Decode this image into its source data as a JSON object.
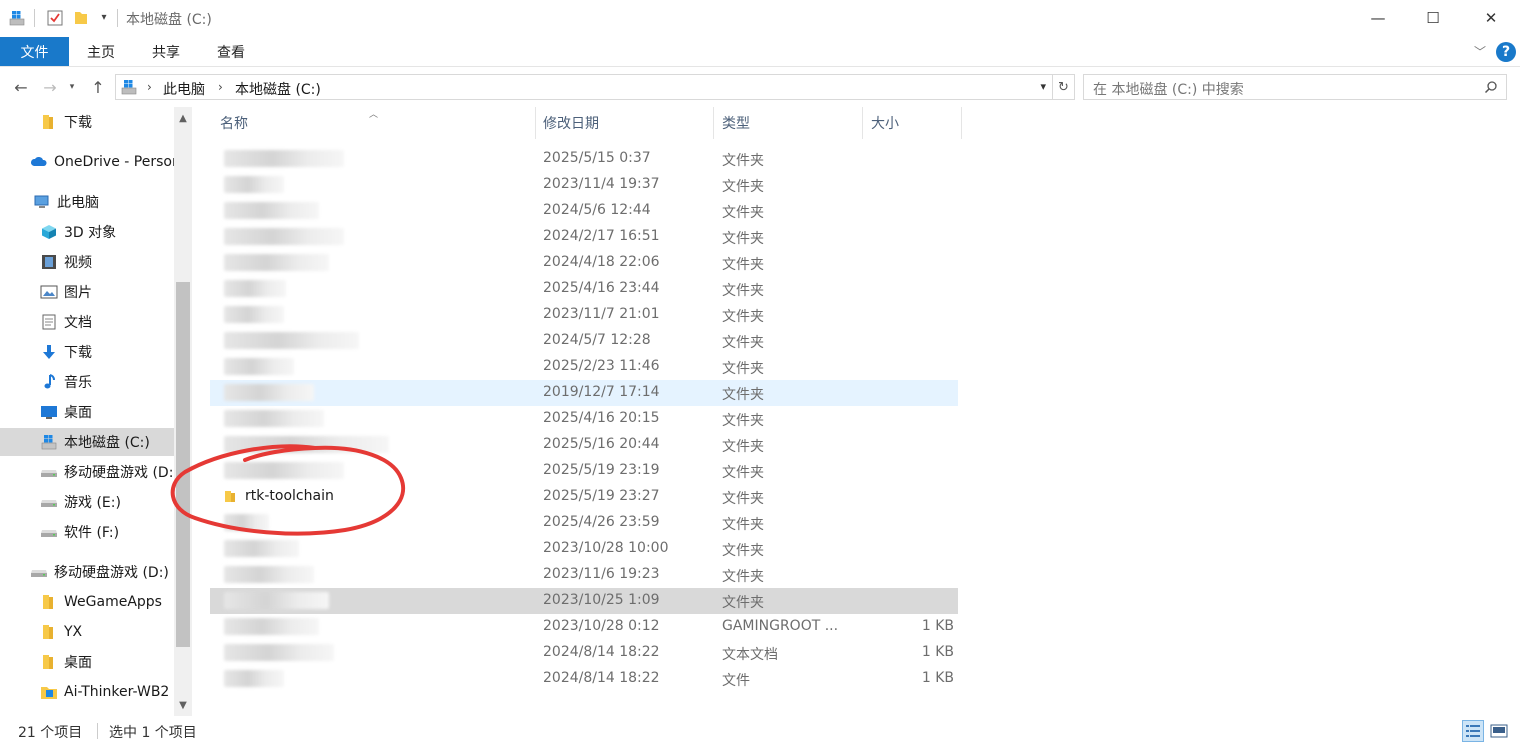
{
  "window": {
    "title": "本地磁盘 (C:)",
    "controls": {
      "minimize": "—",
      "maximize": "☐",
      "close": "✕"
    }
  },
  "ribbon": {
    "tabs": [
      "文件",
      "主页",
      "共享",
      "查看"
    ],
    "help": "?"
  },
  "address": {
    "breadcrumb": [
      "此电脑",
      "本地磁盘 (C:)"
    ],
    "search_placeholder": "在 本地磁盘 (C:) 中搜索"
  },
  "sidebar": {
    "items": [
      {
        "label": "下载",
        "icon": "folder-icon"
      },
      {
        "label": "OneDrive - Personal",
        "icon": "cloud-icon"
      },
      {
        "label": "此电脑",
        "icon": "computer-icon"
      },
      {
        "label": "3D 对象",
        "icon": "cube-icon"
      },
      {
        "label": "视频",
        "icon": "film-icon"
      },
      {
        "label": "图片",
        "icon": "picture-icon"
      },
      {
        "label": "文档",
        "icon": "document-icon"
      },
      {
        "label": "下载",
        "icon": "download-icon"
      },
      {
        "label": "音乐",
        "icon": "music-icon"
      },
      {
        "label": "桌面",
        "icon": "desktop-icon"
      },
      {
        "label": "本地磁盘 (C:)",
        "icon": "windows-drive-icon",
        "selected": true
      },
      {
        "label": "移动硬盘游戏 (D:)",
        "icon": "drive-icon"
      },
      {
        "label": "游戏 (E:)",
        "icon": "drive-icon"
      },
      {
        "label": "软件 (F:)",
        "icon": "drive-icon"
      },
      {
        "label": "移动硬盘游戏 (D:)",
        "icon": "drive-icon"
      },
      {
        "label": "WeGameApps",
        "icon": "folder-icon"
      },
      {
        "label": "YX",
        "icon": "folder-icon"
      },
      {
        "label": "桌面",
        "icon": "folder-icon"
      },
      {
        "label": "Ai-Thinker-WB2",
        "icon": "app-folder-icon"
      }
    ]
  },
  "columns": {
    "name": "名称",
    "date": "修改日期",
    "type": "类型",
    "size": "大小"
  },
  "files": [
    {
      "name": "",
      "date": "2025/5/15 0:37",
      "type": "文件夹",
      "size": ""
    },
    {
      "name": "",
      "date": "2023/11/4 19:37",
      "type": "文件夹",
      "size": ""
    },
    {
      "name": "",
      "date": "2024/5/6 12:44",
      "type": "文件夹",
      "size": ""
    },
    {
      "name": "",
      "date": "2024/2/17 16:51",
      "type": "文件夹",
      "size": ""
    },
    {
      "name": "",
      "date": "2024/4/18 22:06",
      "type": "文件夹",
      "size": ""
    },
    {
      "name": "",
      "date": "2025/4/16 23:44",
      "type": "文件夹",
      "size": ""
    },
    {
      "name": "",
      "date": "2023/11/7 21:01",
      "type": "文件夹",
      "size": ""
    },
    {
      "name": "",
      "date": "2024/5/7 12:28",
      "type": "文件夹",
      "size": ""
    },
    {
      "name": "",
      "date": "2025/2/23 11:46",
      "type": "文件夹",
      "size": ""
    },
    {
      "name": "",
      "date": "2019/12/7 17:14",
      "type": "文件夹",
      "size": "",
      "state": "hover"
    },
    {
      "name": "",
      "date": "2025/4/16 20:15",
      "type": "文件夹",
      "size": ""
    },
    {
      "name": "",
      "date": "2025/5/16 20:44",
      "type": "文件夹",
      "size": ""
    },
    {
      "name": "",
      "date": "2025/5/19 23:19",
      "type": "文件夹",
      "size": ""
    },
    {
      "name": "rtk-toolchain",
      "date": "2025/5/19 23:27",
      "type": "文件夹",
      "size": ""
    },
    {
      "name": "",
      "date": "2025/4/26 23:59",
      "type": "文件夹",
      "size": ""
    },
    {
      "name": "",
      "date": "2023/10/28 10:00",
      "type": "文件夹",
      "size": ""
    },
    {
      "name": "",
      "date": "2023/11/6 19:23",
      "type": "文件夹",
      "size": ""
    },
    {
      "name": "",
      "date": "2023/10/25 1:09",
      "type": "文件夹",
      "size": "",
      "state": "selected"
    },
    {
      "name": "",
      "date": "2023/10/28 0:12",
      "type": "GAMINGROOT ...",
      "size": "1 KB"
    },
    {
      "name": "",
      "date": "2024/8/14 18:22",
      "type": "文本文档",
      "size": "1 KB"
    },
    {
      "name": "",
      "date": "2024/8/14 18:22",
      "type": "文件",
      "size": "1 KB"
    }
  ],
  "status": {
    "count": "21 个项目",
    "selected": "选中 1 个项目"
  },
  "colors": {
    "accent": "#1979ca",
    "selection": "#d9d9d9",
    "hover": "#e5f3ff",
    "annotation": "#e53935"
  }
}
